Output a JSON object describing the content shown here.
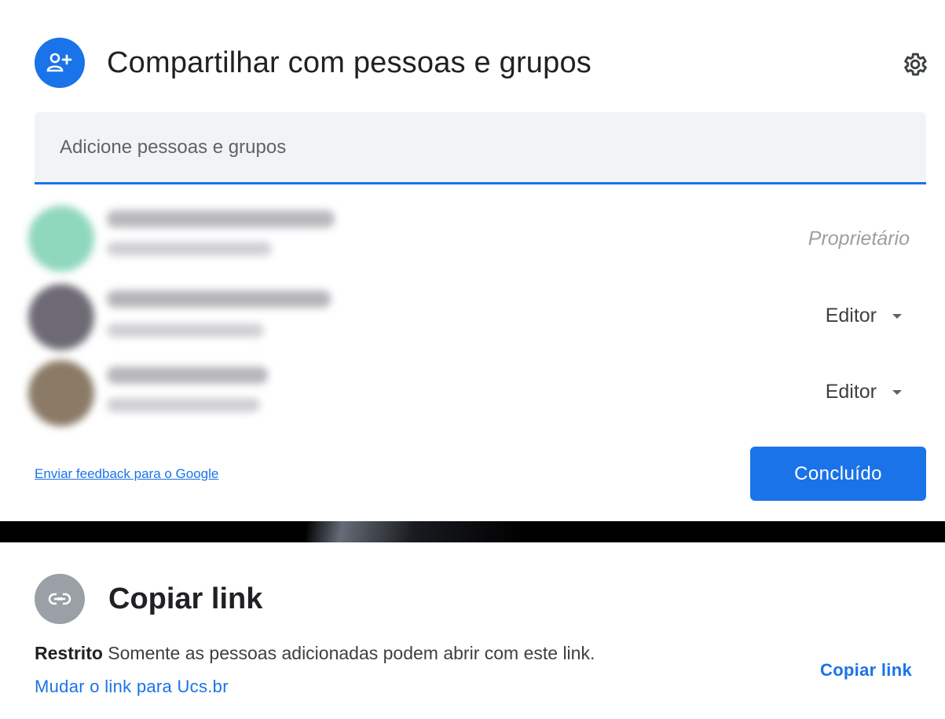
{
  "share_dialog": {
    "title": "Compartilhar com pessoas e grupos",
    "header_icon": "person-add-icon",
    "settings_icon": "gear-icon",
    "input_placeholder": "Adicione pessoas e grupos",
    "people": [
      {
        "role": "Proprietário",
        "role_editable": false,
        "avatar_color": "#8fd7bd"
      },
      {
        "role": "Editor",
        "role_editable": true,
        "avatar_color": "#6d6a74"
      },
      {
        "role": "Editor",
        "role_editable": true,
        "avatar_color": "#8a7a66"
      }
    ],
    "feedback_link": "Enviar feedback para o Google",
    "done_button": "Concluído"
  },
  "link_dialog": {
    "title": "Copiar link",
    "header_icon": "link-icon",
    "restriction_label": "Restrito",
    "restriction_text": "Somente as pessoas adicionadas podem abrir com este link.",
    "change_link": "Mudar o link para Ucs.br",
    "copy_button": "Copiar link"
  },
  "colors": {
    "accent": "#1a73e8",
    "icon_grey": "#9aa0a6",
    "input_bg": "#f1f3f4"
  }
}
